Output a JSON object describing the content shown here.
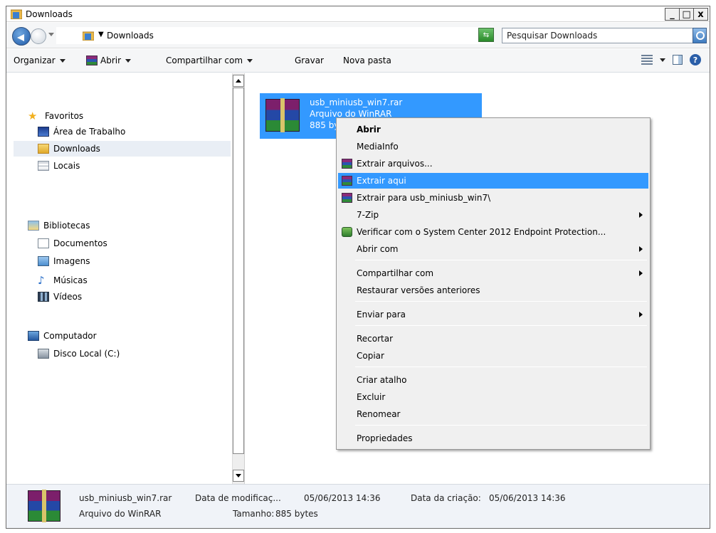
{
  "window": {
    "title": "Downloads"
  },
  "window_buttons": {
    "minimize": "_",
    "maximize": "□",
    "close": "x"
  },
  "address": {
    "location": "Downloads",
    "separator": "▼",
    "search_placeholder": "Pesquisar Downloads"
  },
  "toolbar": {
    "organize": "Organizar",
    "open": "Abrir",
    "share": "Compartilhar com",
    "burn": "Gravar",
    "new_folder": "Nova pasta",
    "help": "?"
  },
  "nav": {
    "favorites": "Favoritos",
    "desktop": "Área de Trabalho",
    "downloads": "Downloads",
    "places": "Locais",
    "libraries": "Bibliotecas",
    "documents": "Documentos",
    "images": "Imagens",
    "music": "Músicas",
    "videos": "Vídeos",
    "computer": "Computador",
    "local_disk": "Disco Local (C:)"
  },
  "file": {
    "name": "usb_miniusb_win7.rar",
    "type": "Arquivo do WinRAR",
    "size": "885 bytes"
  },
  "context_menu": [
    "Abrir",
    "MediaInfo",
    "Extrair arquivos...",
    "Extrair aqui",
    "Extrair para usb_miniusb_win7\\",
    "7-Zip",
    "Verificar com o System Center 2012 Endpoint Protection...",
    "Abrir com",
    "Compartilhar com",
    "Restaurar versões anteriores",
    "Enviar para",
    "Recortar",
    "Copiar",
    "Criar atalho",
    "Excluir",
    "Renomear",
    "Propriedades"
  ],
  "details": {
    "name": "usb_miniusb_win7.rar",
    "type": "Arquivo do WinRAR",
    "modified_label": "Data de modificaç...",
    "modified_value": "05/06/2013 14:36",
    "created_label": "Data da criação:",
    "created_value": "05/06/2013 14:36",
    "size_label": "Tamanho:",
    "size_value": "885 bytes"
  },
  "colors": {
    "selection": "#3399ff",
    "menu_bg": "#f0f0f0"
  }
}
